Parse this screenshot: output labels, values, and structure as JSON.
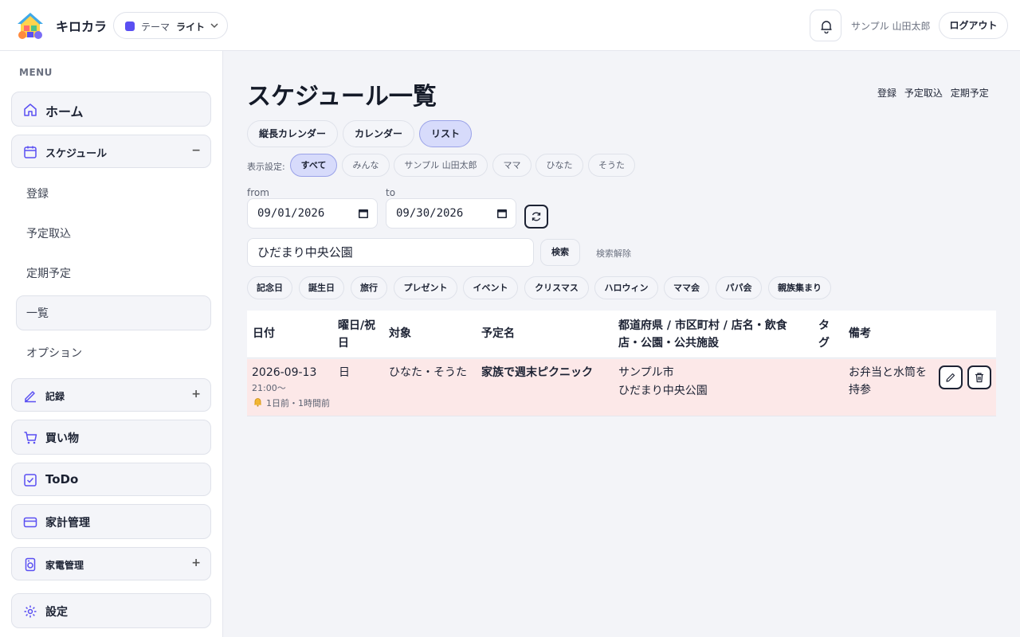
{
  "header": {
    "app_name": "キロカラ",
    "theme_label": "テーマ",
    "theme_value": "ライト",
    "user_name": "サンプル 山田太郎",
    "logout_label": "ログアウト"
  },
  "colors": {
    "accent": "#5a4ff2",
    "row_highlight": "#fce8e8",
    "active_chip": "#d7dbfb"
  },
  "sidebar": {
    "caption": "MENU",
    "home": "ホーム",
    "schedule": "スケジュール",
    "schedule_toggle": "−",
    "schedule_sub": [
      "登録",
      "予定取込",
      "定期予定",
      "一覧",
      "オプション"
    ],
    "records": "記録",
    "records_toggle": "+",
    "shopping": "買い物",
    "todo": "ToDo",
    "budget": "家計管理",
    "appliances": "家電管理",
    "appliances_toggle": "+",
    "settings": "設定"
  },
  "main": {
    "title": "スケジュール一覧",
    "top_links": [
      "登録",
      "予定取込",
      "定期予定"
    ],
    "view_tabs": [
      "縦長カレンダー",
      "カレンダー",
      "リスト"
    ],
    "filter_caption": "表示設定:",
    "member_chips": [
      "すべて",
      "みんな",
      "サンプル 山田太郎",
      "ママ",
      "ひなた",
      "そうた"
    ],
    "from_label": "from",
    "to_label": "to",
    "from_date": "09/01/2026",
    "to_date": "09/30/2026",
    "search_value": "ひだまり中央公園",
    "search_button": "検索",
    "clear_search": "検索解除",
    "tags": [
      "記念日",
      "誕生日",
      "旅行",
      "プレゼント",
      "イベント",
      "クリスマス",
      "ハロウィン",
      "ママ会",
      "パパ会",
      "親族集まり"
    ]
  },
  "table": {
    "headers": {
      "date": "日付",
      "weekday": "曜日/祝日",
      "target": "対象",
      "name": "予定名",
      "place": "都道府県 / 市区町村 / 店名・飲食店・公園・公共施設",
      "tag": "タグ",
      "note": "備考"
    },
    "rows": [
      {
        "date": "2026-09-13",
        "time": "21:00〜",
        "reminder": "1日前・1時間前",
        "weekday": "日",
        "target": "ひなた・そうた",
        "name": "家族で週末ピクニック",
        "place_line1": "サンプル市",
        "place_line2": "ひだまり中央公園",
        "tag": "",
        "note": "お弁当と水筒を持参"
      }
    ]
  }
}
